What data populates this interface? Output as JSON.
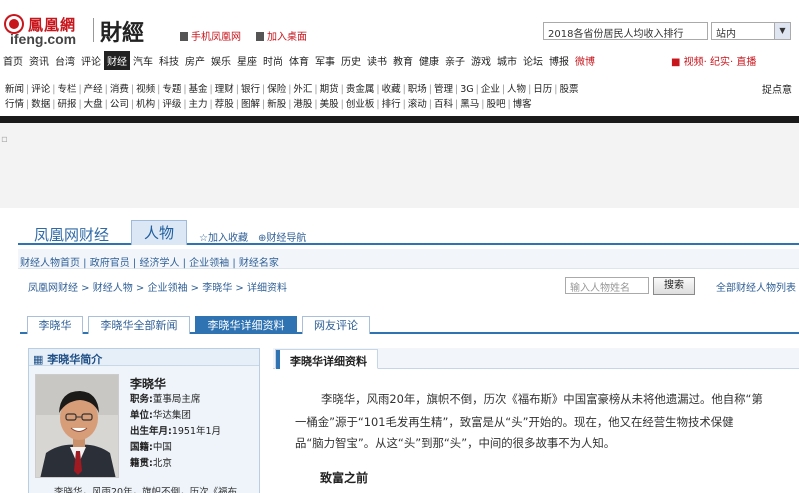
{
  "header": {
    "logo_cn": "鳳凰網",
    "logo_en": "ifeng.com",
    "channel": "財經",
    "mobile_link": "手机凤凰网",
    "desktop_link": "加入桌面",
    "search_value": "2018各省份居民人均收入排行",
    "site_select": "站内"
  },
  "main_nav": [
    "首页",
    "资讯",
    "台湾",
    "评论",
    "财经",
    "汽车",
    "科技",
    "房产",
    "娱乐",
    "星座",
    "时尚",
    "体育",
    "军事",
    "历史",
    "读书",
    "教育",
    "健康",
    "亲子",
    "游戏",
    "城市",
    "论坛",
    "博报",
    "微博"
  ],
  "main_nav_active": "财经",
  "nav_right": "视频· 纪实· 直播",
  "subnav1": [
    "新闻",
    "评论",
    "专栏",
    "产经",
    "消费",
    "视频",
    "专题",
    "基金",
    "理财",
    "银行",
    "保险",
    "外汇",
    "期货",
    "贵金属",
    "收藏",
    "职场",
    "管理",
    "3G",
    "企业",
    "人物",
    "日历",
    "股票"
  ],
  "subnav2": [
    "行情",
    "数据",
    "研报",
    "大盘",
    "公司",
    "机构",
    "评级",
    "主力",
    "荐股",
    "图解",
    "新股",
    "港股",
    "美股",
    "创业板",
    "排行",
    "滚动",
    "百科",
    "黑马",
    "股吧",
    "博客"
  ],
  "hot_points": "捉点意",
  "fin": {
    "title": "凤凰网财经",
    "people_tab": "人物",
    "fav": "加入收藏",
    "nav": "财经导航",
    "categories": "财经人物首页 | 政府官员 | 经济学人 | 企业领袖 | 财经名家",
    "breadcrumb": "凤凰网财经 > 财经人物 > 企业领袖 > 李晓华 > 详细资料",
    "search_placeholder": "输入人物姓名",
    "search_btn": "搜索",
    "all_list": "全部财经人物列表"
  },
  "tabs": [
    {
      "label": "李晓华"
    },
    {
      "label": "李晓华全部新闻"
    },
    {
      "label": "李晓华详细资料"
    },
    {
      "label": "网友评论"
    }
  ],
  "profile": {
    "heading": "李晓华简介",
    "name": "李晓华",
    "job_label": "职务:",
    "job": "董事局主席",
    "unit_label": "单位:",
    "unit": "华达集团",
    "birth_label": "出生年月:",
    "birth": "1951年1月",
    "nation_label": "国籍:",
    "nation": "中国",
    "origin_label": "籍贯:",
    "origin": "北京",
    "bio": "李晓华，风雨20年，旗帜不倒，历次《福布"
  },
  "detail": {
    "title": "李晓华详细资料",
    "para1_l1": "李晓华，风雨20年，旗帜不倒，历次《福布斯》中国富豪榜从未将他遗漏过。他自称“第",
    "para1_l2": "一桶金”源于“101毛发再生精”，致富是从“头”开始的。现在，他又在经营生物技术保健",
    "para1_l3": "品“脑力智宝”。从这“头”到那“头”，中间的很多故事不为人知。",
    "subhead": "致富之前"
  }
}
